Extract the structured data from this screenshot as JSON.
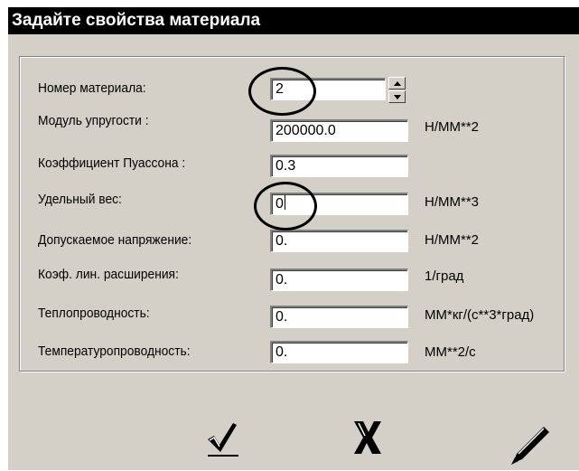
{
  "dialog": {
    "title": "Задайте свойства материала"
  },
  "fields": {
    "material_number": {
      "label": "Номер материала:",
      "value": "2",
      "unit": ""
    },
    "elastic_modulus": {
      "label": "Модуль упругости :",
      "value": "200000.0",
      "unit": "Н/ММ**2"
    },
    "poisson_ratio": {
      "label": "Коэффициент  Пуассона :",
      "value": "0.3",
      "unit": ""
    },
    "specific_weight": {
      "label": "Удельный вес:",
      "value": "0",
      "unit": "Н/ММ**3"
    },
    "allowable_stress": {
      "label": "Допускаемое напряжение:",
      "value": "0.",
      "unit": "Н/ММ**2"
    },
    "thermal_expansion": {
      "label": "Коэф. лин. расширения:",
      "value": "0.",
      "unit": "1/град"
    },
    "thermal_conductivity": {
      "label": "Теплопроводность:",
      "value": "0.",
      "unit": "ММ*кг/(с**3*град)"
    },
    "thermal_diffusivity": {
      "label": "Температуропроводность:",
      "value": "0.",
      "unit": "ММ**2/с"
    }
  },
  "icons": {
    "ok": "checkmark-icon",
    "cancel": "cross-icon",
    "edit": "pen-icon",
    "spin_up": "arrow-up-icon",
    "spin_down": "arrow-down-icon"
  },
  "colors": {
    "title_bg": "#000000",
    "title_text": "#ffffff",
    "dialog_bg": "#d4d0c8",
    "annotation": "#000000"
  }
}
